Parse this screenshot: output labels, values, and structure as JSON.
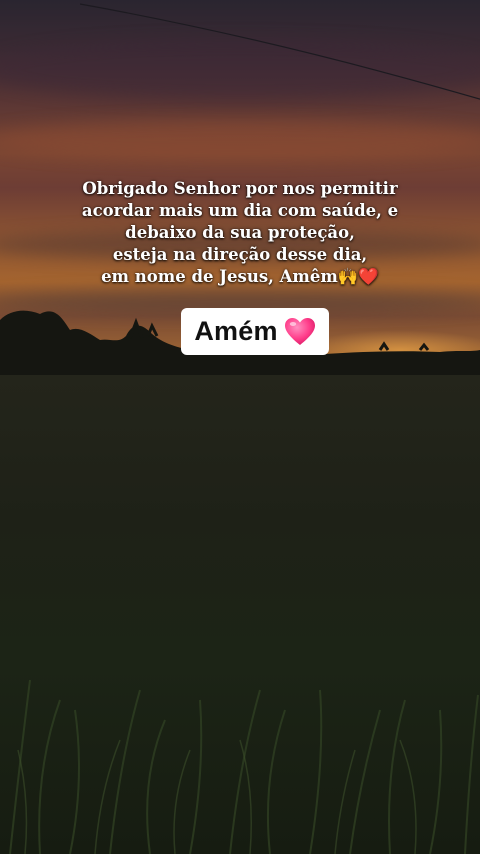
{
  "post": {
    "caption_lines": [
      "Obrigado Senhor por nos permitir",
      "acordar mais um dia com saúde, e",
      "debaixo da sua proteção,",
      "esteja na direção desse dia,",
      "em nome de Jesus, Amêm🙌❤️"
    ],
    "sticker": {
      "label": "Amém",
      "icon": "pink-heart-icon",
      "icon_color": "#ff3d8a"
    }
  },
  "colors": {
    "sky_top": "#2a2530",
    "sunset_orange": "#b8772f",
    "field_dark": "#1a1c15"
  }
}
